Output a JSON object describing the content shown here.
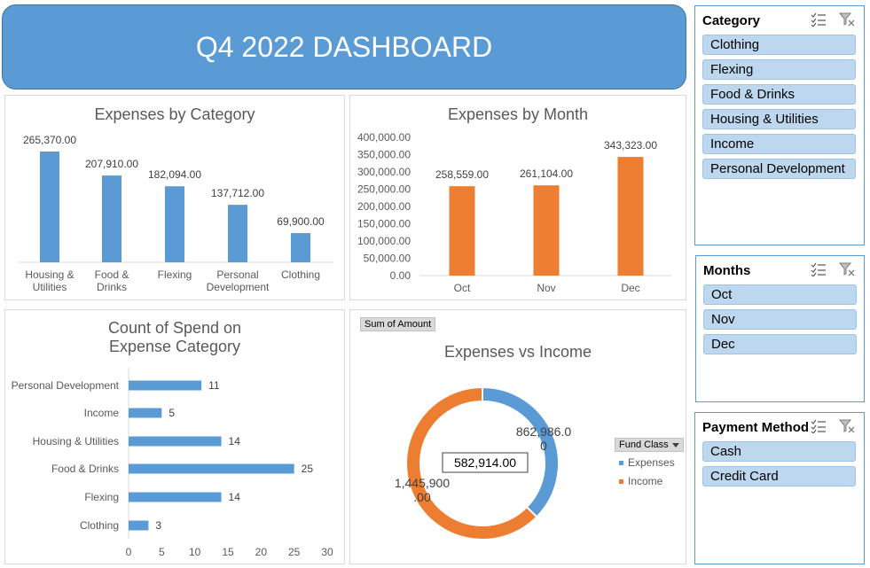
{
  "dashboard": {
    "title": "Q4 2022 DASHBOARD",
    "accent": "#5b9bd5",
    "orange": "#ed7d31"
  },
  "chart_data": [
    {
      "type": "bar",
      "title": "Expenses by Category",
      "categories": [
        [
          "Housing &",
          "Utilities"
        ],
        [
          "Food &",
          "Drinks"
        ],
        [
          "Flexing"
        ],
        [
          "Personal",
          "Development"
        ],
        [
          "Clothing"
        ]
      ],
      "values": [
        265370,
        207910,
        182094,
        137712,
        69900
      ],
      "value_labels": [
        "265,370.00",
        "207,910.00",
        "182,094.00",
        "137,712.00",
        "69,900.00"
      ],
      "color": "#5b9bd5"
    },
    {
      "type": "bar",
      "title": "Expenses by Month",
      "categories": [
        "Oct",
        "Nov",
        "Dec"
      ],
      "values": [
        258559,
        261104,
        343323
      ],
      "value_labels": [
        "258,559.00",
        "261,104.00",
        "343,323.00"
      ],
      "ylim": [
        0,
        400000
      ],
      "yticks": [
        "0.00",
        "50,000.00",
        "100,000.00",
        "150,000.00",
        "200,000.00",
        "250,000.00",
        "300,000.00",
        "350,000.00",
        "400,000.00"
      ],
      "color": "#ed7d31"
    },
    {
      "type": "bar",
      "orientation": "horizontal",
      "title": "Count of Spend on Expense Category",
      "categories": [
        "Personal Development",
        "Income",
        "Housing & Utilities",
        "Food & Drinks",
        "Flexing",
        "Clothing"
      ],
      "values": [
        11,
        5,
        14,
        25,
        14,
        3
      ],
      "xlim": [
        0,
        30
      ],
      "xticks": [
        "0",
        "5",
        "10",
        "15",
        "20",
        "25",
        "30"
      ],
      "color": "#5b9bd5"
    },
    {
      "type": "pie",
      "title": "Expenses vs Income",
      "field_button": "Sum of Amount",
      "legend_title": "Fund Class",
      "series": [
        {
          "name": "Expenses",
          "value": 862986,
          "label_lines": [
            "862,986.0",
            "0"
          ],
          "color": "#5b9bd5"
        },
        {
          "name": "Income",
          "value": 1445900,
          "label_lines": [
            "1,445,900",
            ".00"
          ],
          "color": "#ed7d31"
        }
      ],
      "center_label": "582,914.00"
    }
  ],
  "slicers": [
    {
      "title": "Category",
      "items": [
        "Clothing",
        "Flexing",
        "Food & Drinks",
        "Housing & Utilities",
        "Income",
        "Personal Development"
      ]
    },
    {
      "title": "Months",
      "items": [
        "Oct",
        "Nov",
        "Dec"
      ]
    },
    {
      "title": "Payment Method",
      "items": [
        "Cash",
        "Credit Card"
      ]
    }
  ]
}
